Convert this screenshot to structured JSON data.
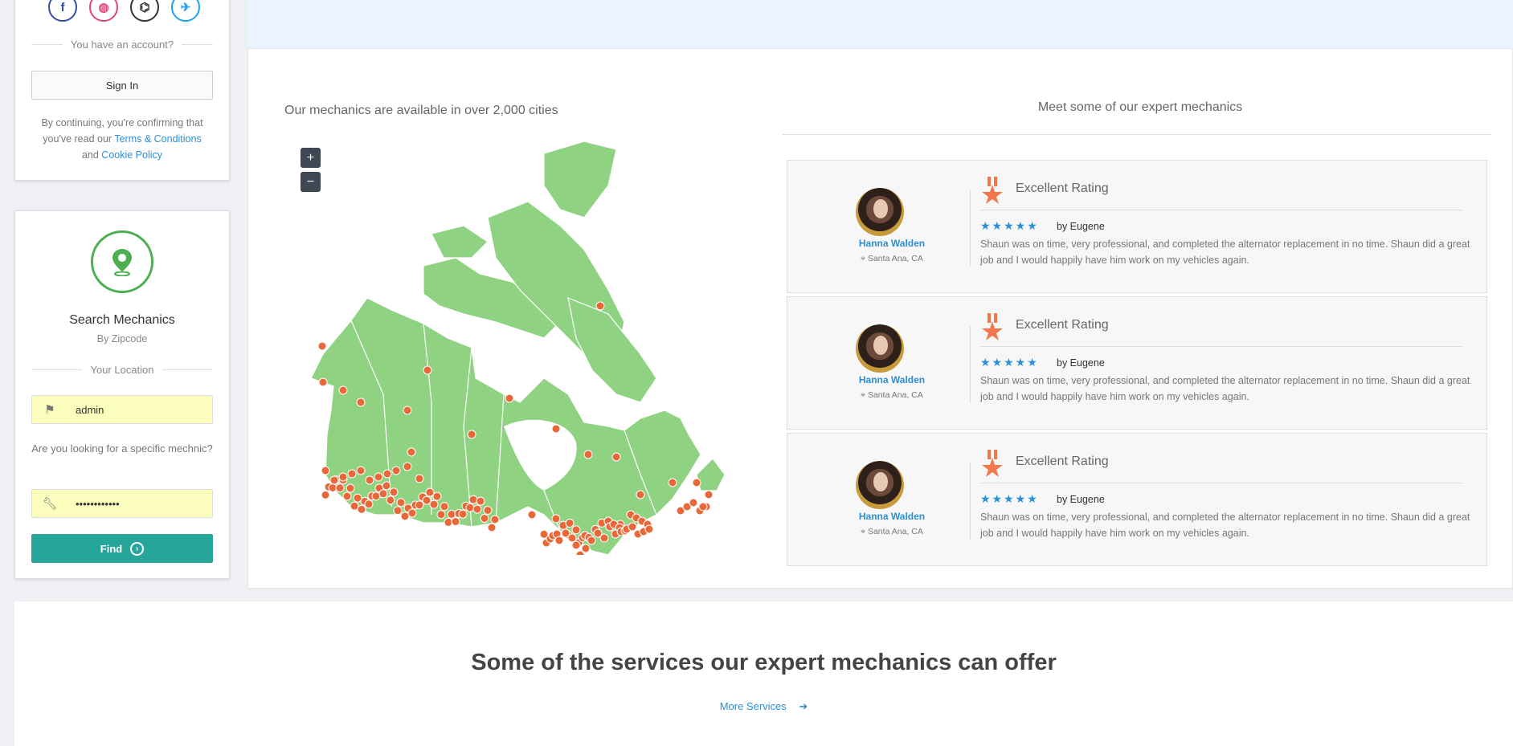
{
  "sidebar": {
    "socials": [
      {
        "name": "facebook-icon",
        "glyph": "f",
        "color": "#3b4ba0"
      },
      {
        "name": "dribbble-icon",
        "glyph": "◍",
        "color": "#e3447b"
      },
      {
        "name": "github-icon",
        "glyph": "⌬",
        "color": "#333333"
      },
      {
        "name": "twitter-icon",
        "glyph": "✈",
        "color": "#1da1f2"
      }
    ],
    "account_prompt": "You have an account?",
    "sign_in": "Sign In",
    "legal_prefix": "By continuing, you're confirming that you've read our",
    "terms_link": "Terms & Conditions",
    "legal_and": "and",
    "cookie_link": "Cookie Policy"
  },
  "search": {
    "title": "Search Mechanics",
    "subtitle": "By Zipcode",
    "location_label": "Your Location",
    "location_value": "admin",
    "question": "Are you looking for a specific mechnic?",
    "mechanic_value": "••••••••••••",
    "find_label": "Find"
  },
  "map": {
    "title": "Our mechanics are available in over 2,000 cities",
    "zoom_in": "+",
    "zoom_out": "−"
  },
  "experts": {
    "title": "Meet some of our expert mechanics",
    "reviews": [
      {
        "name": "Hanna Walden",
        "location": "Santa Ana, CA",
        "rating_label": "Excellent Rating",
        "stars": 5,
        "by": "by Eugene",
        "text": "Shaun was on time, very professional, and completed the alternator replacement in no time. Shaun did a great job and I would happily have him work on my vehicles again."
      },
      {
        "name": "Hanna Walden",
        "location": "Santa Ana, CA",
        "rating_label": "Excellent Rating",
        "stars": 5,
        "by": "by Eugene",
        "text": "Shaun was on time, very professional, and completed the alternator replacement in no time. Shaun did a great job and I would happily have him work on my vehicles again."
      },
      {
        "name": "Hanna Walden",
        "location": "Santa Ana, CA",
        "rating_label": "Excellent Rating",
        "stars": 5,
        "by": "by Eugene",
        "text": "Shaun was on time, very professional, and completed the alternator replacement in no time. Shaun did a great job and I would happily have him work on my vehicles again."
      }
    ]
  },
  "services": {
    "title": "Some of the services our expert mechanics can offer",
    "more_link": "More Services"
  },
  "colors": {
    "accent": "#26a69a",
    "link": "#2b8fd6",
    "map_land": "#8fd282",
    "map_marker": "#e8683a",
    "star": "#2b8fd6"
  }
}
